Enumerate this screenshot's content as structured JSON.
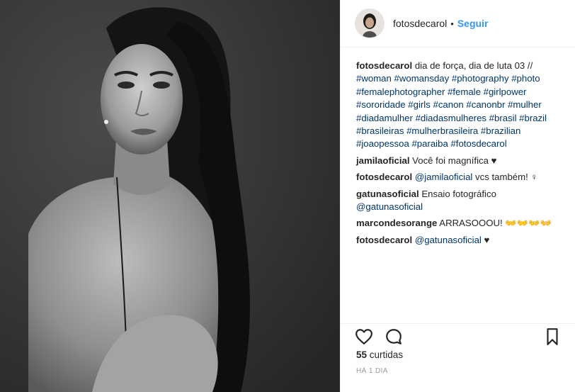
{
  "post": {
    "author": "fotosdecarol",
    "separator": "•",
    "follow_label": "Seguir",
    "caption": {
      "user": "fotosdecarol",
      "text": "dia de força, dia de luta 03 //",
      "hashtags_line1": "#woman #womansday #photography #photo",
      "hashtags_line2": "#femalephotographer #female #girlpower",
      "hashtags_line3": "#sororidade #girls #canon #canonbr #mulher",
      "hashtags_line4": "#diadamulher #diadasmulheres #brasil #brazil",
      "hashtags_line5": "#brasileiras #mulherbrasileira #brazilian",
      "hashtags_line6": "#joaopessoa #paraiba #fotosdecarol"
    },
    "comments": [
      {
        "user": "jamilaoficial",
        "text": "Você foi magnífica ♥"
      },
      {
        "user": "fotosdecarol",
        "mention": "@jamilaoficial",
        "text": " vcs também! ♀"
      },
      {
        "user": "gatunasoficial",
        "text": "Ensaio fotográfico",
        "mention": "@gatunasoficial"
      },
      {
        "user": "marcondesorange",
        "text": "ARRASOOOU! 👐👐👐👐"
      },
      {
        "user": "fotosdecarol",
        "mention": "@gatunasoficial",
        "text": " ♥"
      }
    ],
    "likes_count": "55",
    "likes_word": "curtidas",
    "time_ago": "HÁ 1 DIA",
    "icons": {
      "like": "heart-icon",
      "comment": "comment-bubble-icon",
      "save": "bookmark-icon"
    },
    "colors": {
      "link": "#3897f0",
      "hashtag": "#003569",
      "meta": "#999999"
    }
  }
}
